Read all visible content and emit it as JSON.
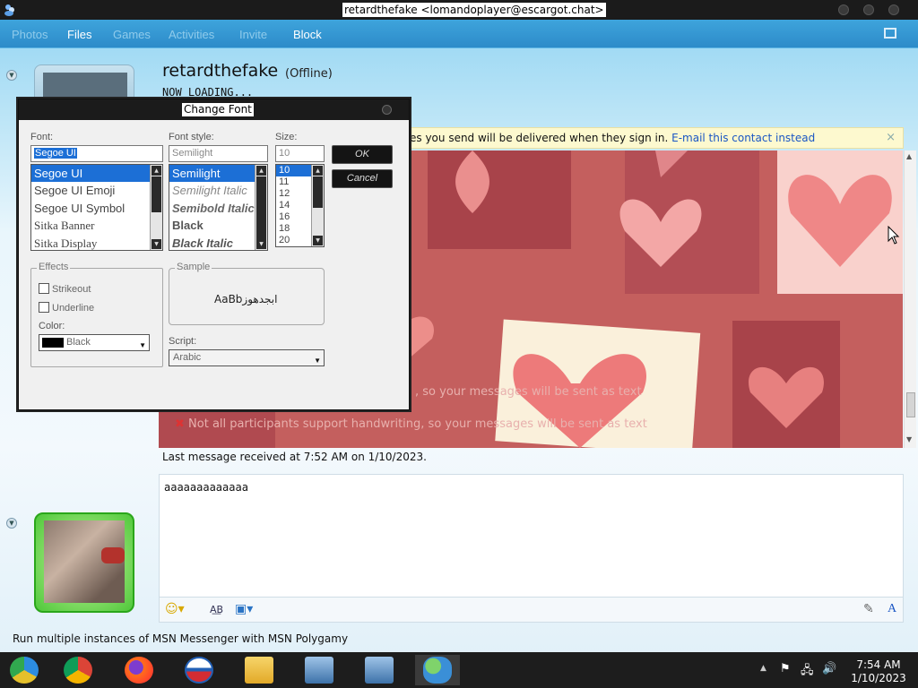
{
  "window": {
    "title": "retardthefake <lomandoplayer@escargot.chat>"
  },
  "toolbar": {
    "items": [
      "Photos",
      "Files",
      "Games",
      "Activities",
      "Invite",
      "Block"
    ]
  },
  "contact": {
    "name": "retardthefake",
    "status": "(Offline)",
    "personal_message": "NOW LOADING..."
  },
  "infobar": {
    "text": "es you send will be delivered when they sign in.",
    "link": "E-mail this contact instead",
    "close": "×"
  },
  "conversation": {
    "notices": [
      ", so your messages will be sent as text",
      "Not all participants support handwriting, so your messages will be sent as text"
    ],
    "last_message": "Last message received at 7:52 AM on 1/10/2023."
  },
  "compose": {
    "text": "aaaaaaaaaaaaa"
  },
  "promo": "Run multiple instances of MSN Messenger with MSN Polygamy",
  "dialog": {
    "title": "Change Font",
    "font_label": "Font:",
    "font_value": "Segoe UI",
    "fonts": [
      "Segoe UI",
      "Segoe UI Emoji",
      "Segoe UI Symbol",
      "Sitka Banner",
      "Sitka Display"
    ],
    "style_label": "Font style:",
    "style_value": "Semilight",
    "styles": [
      "Semilight",
      "Semilight Italic",
      "Semibold Italic",
      "Black",
      "Black Italic"
    ],
    "size_label": "Size:",
    "size_value": "10",
    "sizes": [
      "10",
      "11",
      "12",
      "14",
      "16",
      "18",
      "20"
    ],
    "ok": "OK",
    "cancel": "Cancel",
    "effects_label": "Effects",
    "strikeout": "Strikeout",
    "underline": "Underline",
    "color_label": "Color:",
    "color_value": "Black",
    "sample_label": "Sample",
    "sample_text": "AaBbابجدهوز",
    "script_label": "Script:",
    "script_value": "Arabic"
  },
  "taskbar": {
    "time": "7:54 AM",
    "date": "1/10/2023"
  },
  "colors": {
    "accent": "#2d8bc9",
    "selection": "#1c6fd6",
    "link": "#1a56c4"
  }
}
